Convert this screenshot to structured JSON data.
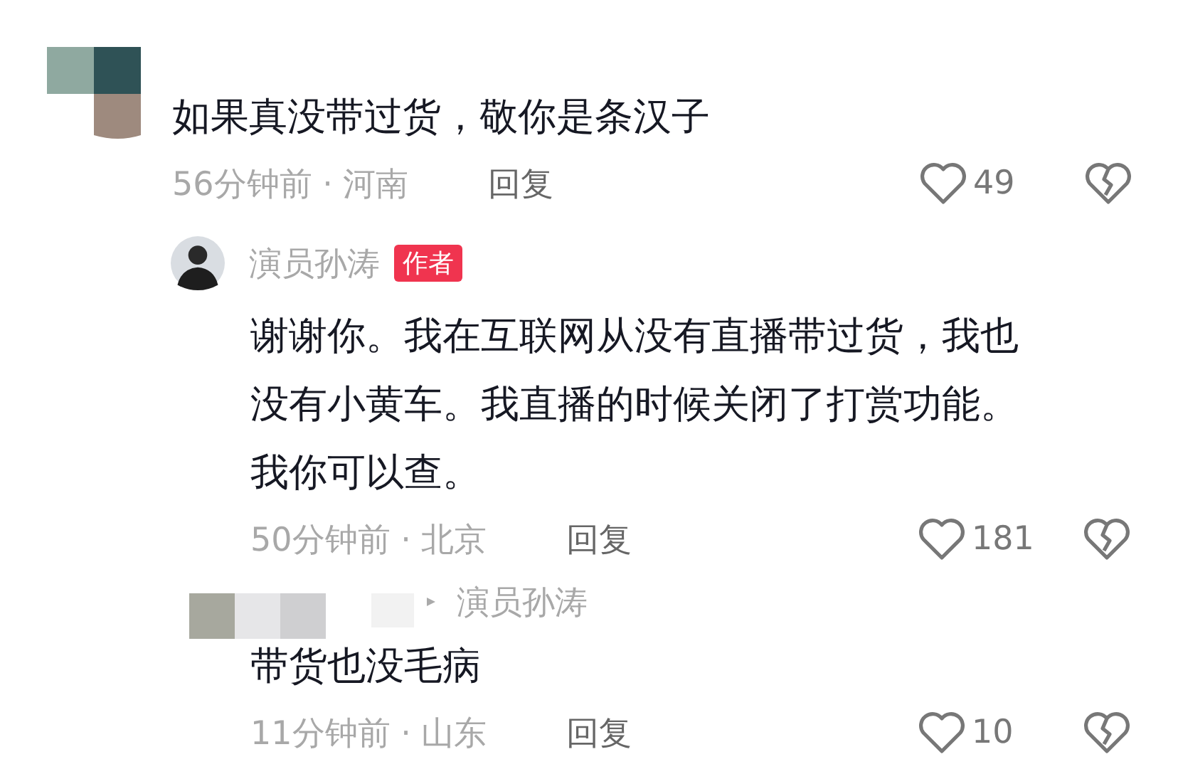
{
  "comment": {
    "avatar": {
      "kind": "pixelated"
    },
    "lines": [
      "如果真没带过货，敬你是条汉子"
    ],
    "meta": "56分钟前 · 河南",
    "reply_label": "回复",
    "likes": "49"
  },
  "replies": [
    {
      "avatar": {
        "kind": "photo"
      },
      "username": "演员孙涛",
      "badge": "作者",
      "lines": [
        "谢谢你。我在互联网从没有直播带过货，我也",
        "没有小黄车。我直播的时候关闭了打赏功能。",
        "我你可以查。"
      ],
      "meta": "50分钟前 · 北京",
      "reply_label": "回复",
      "likes": "181"
    },
    {
      "avatar": {
        "kind": "pixelated-name"
      },
      "reply_to": "演员孙涛",
      "lines": [
        "带货也没毛病"
      ],
      "meta": "11分钟前 · 山东",
      "reply_label": "回复",
      "likes": "10"
    }
  ]
}
